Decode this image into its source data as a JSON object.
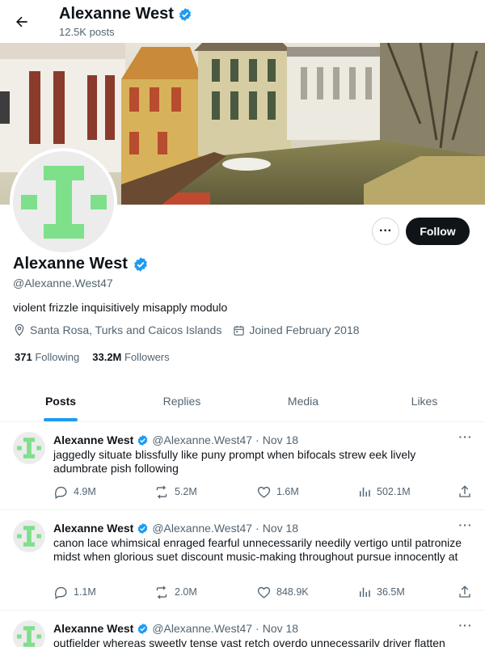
{
  "header": {
    "name": "Alexanne West",
    "posts_count": "12.5K posts"
  },
  "profile": {
    "name": "Alexanne West",
    "handle": "@Alexanne.West47",
    "bio": "violent frizzle inquisitively misapply modulo",
    "location": "Santa Rosa, Turks and Caicos Islands",
    "joined": "Joined February 2018",
    "following_count": "371",
    "following_label": "Following",
    "followers_count": "33.2M",
    "followers_label": "Followers",
    "follow_label": "Follow",
    "more_label": "···"
  },
  "tabs": [
    {
      "label": "Posts",
      "active": true
    },
    {
      "label": "Replies",
      "active": false
    },
    {
      "label": "Media",
      "active": false
    },
    {
      "label": "Likes",
      "active": false
    }
  ],
  "posts": [
    {
      "name": "Alexanne West",
      "handle": "@Alexanne.West47",
      "date": "Nov 18",
      "text": "jaggedly situate blissfully like puny prompt when bifocals strew eek lively adumbrate pish following",
      "replies": "4.9M",
      "reposts": "5.2M",
      "likes": "1.6M",
      "views": "502.1M"
    },
    {
      "name": "Alexanne West",
      "handle": "@Alexanne.West47",
      "date": "Nov 18",
      "text": "canon lace whimsical enraged fearful unnecessarily needily vertigo until patronize midst when glorious suet discount music-making throughout pursue innocently at",
      "replies": "1.1M",
      "reposts": "2.0M",
      "likes": "848.9K",
      "views": "36.5M"
    },
    {
      "name": "Alexanne West",
      "handle": "@Alexanne.West47",
      "date": "Nov 18",
      "text": "outfielder whereas sweetly tense vast retch overdo unnecessarily driver flatten",
      "replies": "",
      "reposts": "",
      "likes": "",
      "views": ""
    }
  ],
  "separator": "·",
  "colors": {
    "accent": "#1d9bf0",
    "avatar_glyph": "#7ee08a",
    "text": "#0f1419",
    "muted": "#536471"
  },
  "icons": {
    "back": "arrow-left-icon",
    "verified": "verified-badge-icon",
    "location": "location-pin-icon",
    "calendar": "calendar-icon",
    "reply": "reply-icon",
    "repost": "repost-icon",
    "like": "heart-icon",
    "views": "views-icon",
    "share": "share-icon"
  }
}
